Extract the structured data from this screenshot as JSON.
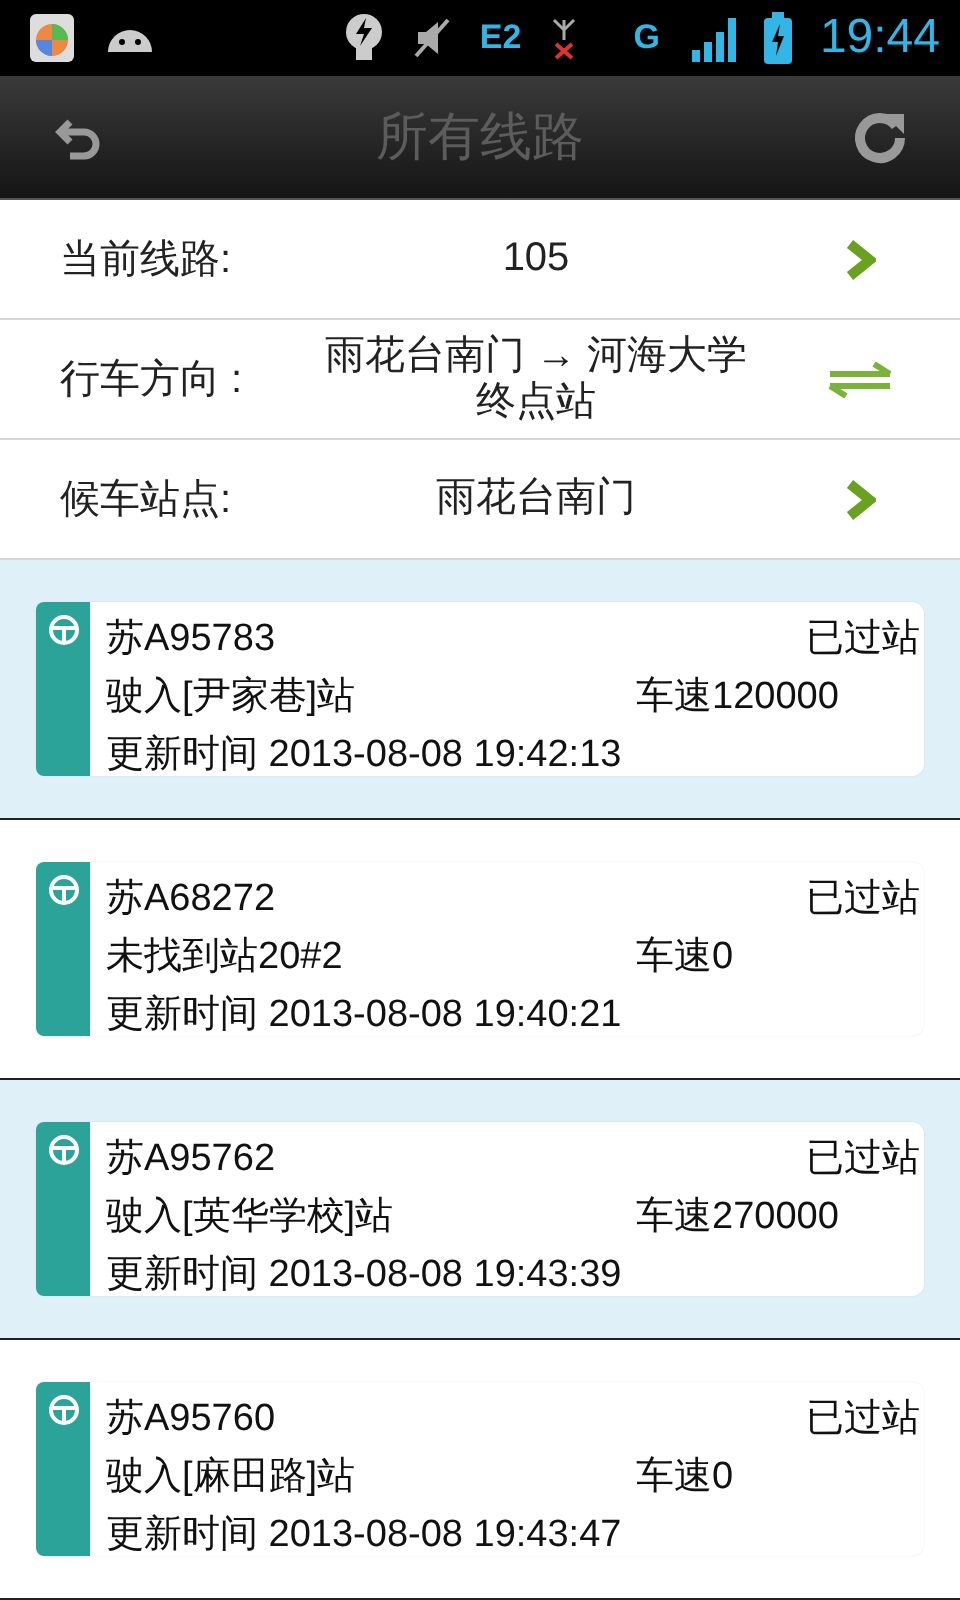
{
  "status_bar": {
    "network_1": "E2",
    "network_2": "G",
    "time": "19:44"
  },
  "title_bar": {
    "title": "所有线路"
  },
  "info_rows": [
    {
      "kind": "link",
      "label": "当前线路:",
      "value": "105"
    },
    {
      "kind": "swap",
      "label": "行车方向 :",
      "value": "雨花台南门 → 河海大学终点站"
    },
    {
      "kind": "link",
      "label": "候车站点:",
      "value": "雨花台南门"
    }
  ],
  "buses": [
    {
      "plate": "苏A95783",
      "status": "已过站",
      "location": "驶入[尹家巷]站",
      "speed": "车速120000",
      "updated": "更新时间 2013-08-08 19:42:13",
      "highlighted": true
    },
    {
      "plate": "苏A68272",
      "status": "已过站",
      "location": "未找到站20#2",
      "speed": "车速0",
      "updated": "更新时间 2013-08-08 19:40:21",
      "highlighted": false
    },
    {
      "plate": "苏A95762",
      "status": "已过站",
      "location": "驶入[英华学校]站",
      "speed": "车速270000",
      "updated": "更新时间 2013-08-08 19:43:39",
      "highlighted": true
    },
    {
      "plate": "苏A95760",
      "status": "已过站",
      "location": "驶入[麻田路]站",
      "speed": "车速0",
      "updated": "更新时间 2013-08-08 19:43:47",
      "highlighted": false
    }
  ]
}
